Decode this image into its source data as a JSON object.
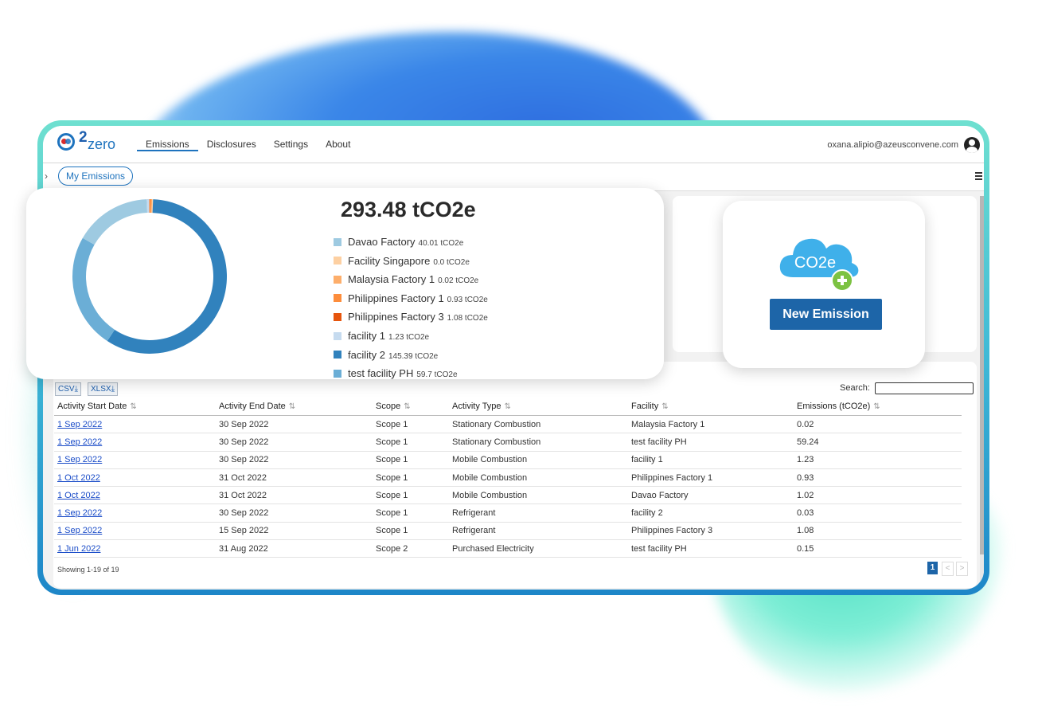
{
  "nav": {
    "logo_num": "2",
    "logo_text": "zero",
    "items": [
      "Emissions",
      "Disclosures",
      "Settings",
      "About"
    ],
    "user_email": "oxana.alipio@azeusconvene.com"
  },
  "subbar": {
    "tab_label": "My Emissions"
  },
  "summary": {
    "total": "293.48 tCO2e",
    "legend": [
      {
        "name": "Davao Factory",
        "value": "40.01 tCO2e",
        "color": "#9ecae1"
      },
      {
        "name": "Facility Singapore",
        "value": "0.0 tCO2e",
        "color": "#fdd0a2"
      },
      {
        "name": "Malaysia Factory 1",
        "value": "0.02 tCO2e",
        "color": "#fdae6b"
      },
      {
        "name": "Philippines Factory 1",
        "value": "0.93 tCO2e",
        "color": "#fd8d3c"
      },
      {
        "name": "Philippines Factory 3",
        "value": "1.08 tCO2e",
        "color": "#e6550d"
      },
      {
        "name": "facility 1",
        "value": "1.23 tCO2e",
        "color": "#c6dbef"
      },
      {
        "name": "facility 2",
        "value": "145.39 tCO2e",
        "color": "#3182bd"
      },
      {
        "name": "test facility PH",
        "value": "59.7 tCO2e",
        "color": "#6baed6"
      }
    ]
  },
  "new_emission": {
    "icon_text": "CO2e",
    "button_label": "New Emission"
  },
  "table": {
    "export_csv": "CSV",
    "export_xlsx": "XLSX",
    "search_label": "Search:",
    "columns": [
      "Activity Start Date",
      "Activity End Date",
      "Scope",
      "Activity Type",
      "Facility",
      "Emissions (tCO2e)"
    ],
    "rows": [
      [
        "1 Sep 2022",
        "30 Sep 2022",
        "Scope 1",
        "Stationary Combustion",
        "Malaysia Factory 1",
        "0.02"
      ],
      [
        "1 Sep 2022",
        "30 Sep 2022",
        "Scope 1",
        "Stationary Combustion",
        "test facility PH",
        "59.24"
      ],
      [
        "1 Sep 2022",
        "30 Sep 2022",
        "Scope 1",
        "Mobile Combustion",
        "facility 1",
        "1.23"
      ],
      [
        "1 Oct 2022",
        "31 Oct 2022",
        "Scope 1",
        "Mobile Combustion",
        "Philippines Factory 1",
        "0.93"
      ],
      [
        "1 Oct 2022",
        "31 Oct 2022",
        "Scope 1",
        "Mobile Combustion",
        "Davao Factory",
        "1.02"
      ],
      [
        "1 Sep 2022",
        "30 Sep 2022",
        "Scope 1",
        "Refrigerant",
        "facility 2",
        "0.03"
      ],
      [
        "1 Sep 2022",
        "15 Sep 2022",
        "Scope 1",
        "Refrigerant",
        "Philippines Factory 3",
        "1.08"
      ],
      [
        "1 Jun 2022",
        "31 Aug 2022",
        "Scope 2",
        "Purchased Electricity",
        "test facility PH",
        "0.15"
      ]
    ],
    "showing": "Showing 1-19 of 19",
    "page_current": "1",
    "page_prev": "<",
    "page_next": ">"
  },
  "chart_data": {
    "type": "pie",
    "categories": [
      "Davao Factory",
      "Facility Singapore",
      "Malaysia Factory 1",
      "Philippines Factory 1",
      "Philippines Factory 3",
      "facility 1",
      "facility 2",
      "test facility PH"
    ],
    "values": [
      40.01,
      0.0,
      0.02,
      0.93,
      1.08,
      1.23,
      145.39,
      59.7
    ],
    "colors": [
      "#9ecae1",
      "#fdd0a2",
      "#fdae6b",
      "#fd8d3c",
      "#e6550d",
      "#c6dbef",
      "#3182bd",
      "#6baed6"
    ],
    "donut": true
  }
}
